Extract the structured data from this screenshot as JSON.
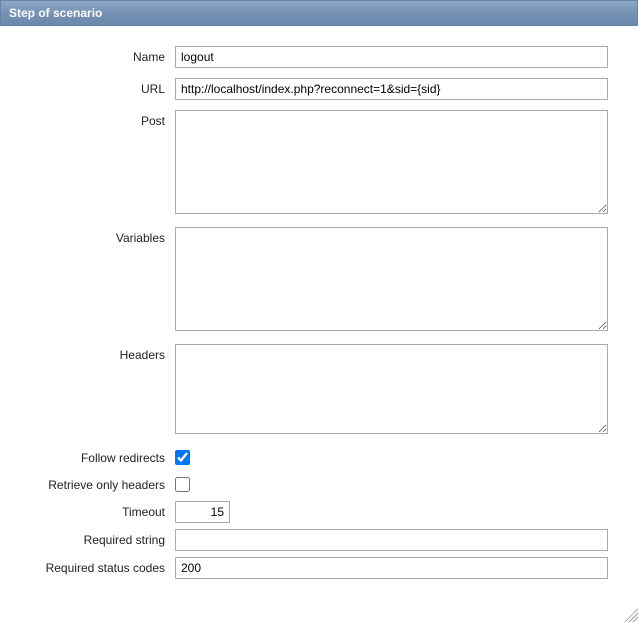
{
  "header": {
    "title": "Step of scenario"
  },
  "form": {
    "name": {
      "label": "Name",
      "value": "logout"
    },
    "url": {
      "label": "URL",
      "value": "http://localhost/index.php?reconnect=1&sid={sid}"
    },
    "post": {
      "label": "Post",
      "value": ""
    },
    "variables": {
      "label": "Variables",
      "value": ""
    },
    "headers": {
      "label": "Headers",
      "value": ""
    },
    "follow_redirects": {
      "label": "Follow redirects",
      "checked": true
    },
    "retrieve_only_headers": {
      "label": "Retrieve only headers",
      "checked": false
    },
    "timeout": {
      "label": "Timeout",
      "value": "15"
    },
    "required_string": {
      "label": "Required string",
      "value": ""
    },
    "required_status_codes": {
      "label": "Required status codes",
      "value": "200"
    }
  }
}
